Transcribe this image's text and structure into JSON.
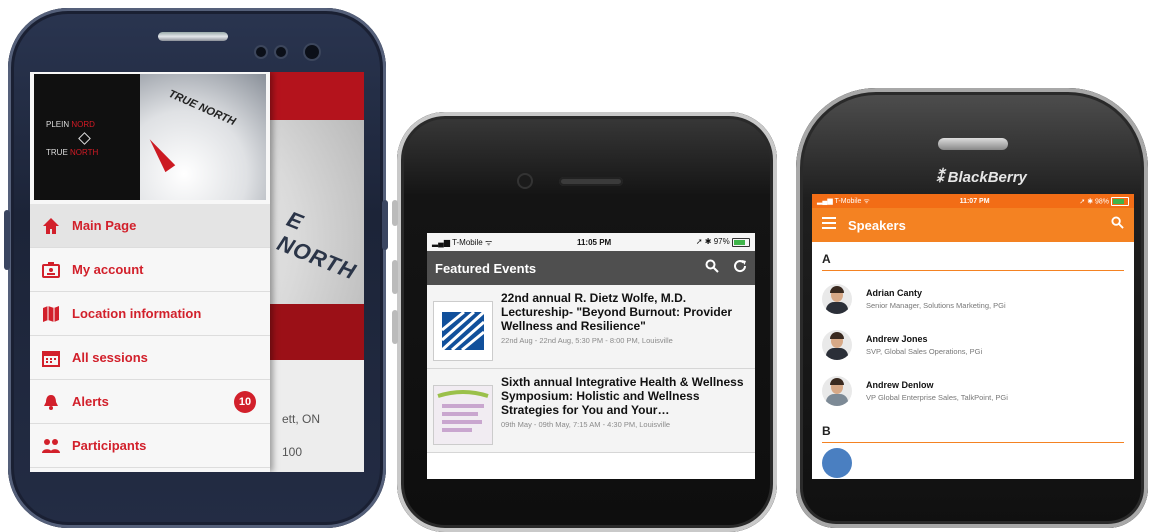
{
  "android": {
    "logo": {
      "plein": "PLEIN",
      "nord": "NORD",
      "true": "TRUE",
      "north": "NORTH"
    },
    "header_caption": "TRUE NORTH",
    "bg_caption": "E NORTH",
    "bg_text_1": "ett, ON",
    "bg_text_2": "100",
    "menu": [
      {
        "label": "Main Page",
        "icon": "home-icon"
      },
      {
        "label": "My account",
        "icon": "account-card-icon"
      },
      {
        "label": "Location information",
        "icon": "map-icon"
      },
      {
        "label": "All sessions",
        "icon": "calendar-icon"
      },
      {
        "label": "Alerts",
        "icon": "bell-icon",
        "badge": "10"
      },
      {
        "label": "Participants",
        "icon": "people-icon"
      }
    ],
    "accent": "#d2202b"
  },
  "iphone": {
    "status": {
      "carrier": "T-Mobile",
      "time": "11:05 PM",
      "battery": "97%"
    },
    "title": "Featured Events",
    "events": [
      {
        "title": "22nd annual R. Dietz Wolfe, M.D. Lectureship- \"Beyond Burnout: Provider Wellness and Resilience\"",
        "meta": "22nd Aug - 22nd Aug, 5:30 PM - 8:00 PM, Louisville"
      },
      {
        "title": "Sixth annual Integrative Health & Wellness Symposium: Holistic and Wellness Strategies for You and Your…",
        "meta": "09th May - 09th May, 7:15 AM - 4:30 PM, Louisville"
      }
    ],
    "appbar_color": "#4f4f4f"
  },
  "blackberry": {
    "brand": "BlackBerry",
    "status": {
      "carrier": "T-Mobile",
      "time": "11:07 PM",
      "battery": "98%"
    },
    "title": "Speakers",
    "section_a": "A",
    "section_b": "B",
    "speakers": [
      {
        "name": "Adrian Canty",
        "role": "Senior Manager, Solutions Marketing, PGi"
      },
      {
        "name": "Andrew Jones",
        "role": "SVP, Global Sales Operations, PGi"
      },
      {
        "name": "Andrew Denlow",
        "role": "VP Global Enterprise Sales, TalkPoint, PGi"
      }
    ],
    "accent": "#f48222"
  }
}
